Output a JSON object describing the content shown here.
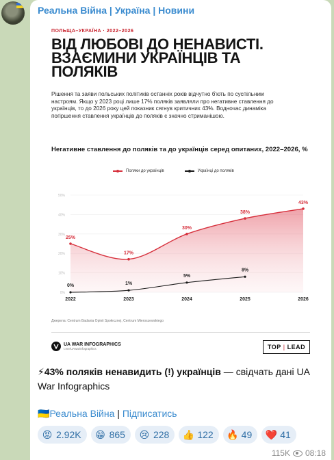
{
  "channel": {
    "title": "Реальна Війна | Україна | Новини"
  },
  "infographic": {
    "eyebrow": "ПОЛЬЩА–УКРАЇНА · 2022–2026",
    "headline": "ВІД ЛЮБОВІ ДО НЕНАВИСТІ. ВЗАЄМИНИ УКРАЇНЦІВ ТА ПОЛЯКІВ",
    "lead": "Рішення та заяви польських політиків останніх років відчутно б'ють по суспільним настроям. Якщо у 2023 році лише 17% поляків заявляли про негативне ставлення до українців, то до 2026 року цей показник сягнув критичних 43%. Водночас динаміка погіршення ставлення українців до поляків є значно стриманішою.",
    "chart_title": "Негативне ставлення до поляків та до українців серед опитаних, 2022–2026, %",
    "source": "Джерела: Centrum Badania Opinii Społecznej, Centrum Mieroszewskiego",
    "brand_name": "UA WAR INFOGRAPHICS",
    "brand_handle": "t.me/UAwarinfographics",
    "badge_left": "TOP",
    "badge_sep": "|",
    "badge_right": "LEAD"
  },
  "chart_data": {
    "type": "area",
    "x": [
      "2022",
      "2023",
      "2024",
      "2025",
      "2026"
    ],
    "ylim": [
      0,
      50
    ],
    "yticks": [
      "0%",
      "10%",
      "20%",
      "30%",
      "40%",
      "50%"
    ],
    "grid": true,
    "legend_position": "top",
    "series": [
      {
        "name": "Поляки до українців",
        "color": "#d62f3b",
        "values": [
          25,
          17,
          30,
          38,
          43
        ],
        "labels": [
          "25%",
          "17%",
          "30%",
          "38%",
          "43%"
        ]
      },
      {
        "name": "Українці до поляків",
        "color": "#1a1a1a",
        "values": [
          0,
          1,
          5,
          8,
          null
        ],
        "labels": [
          "0%",
          "1%",
          "5%",
          "8%",
          ""
        ]
      }
    ]
  },
  "post": {
    "bolt": "⚡",
    "bold_text": "43% поляків ненавидить (!) українців",
    "rest_text": " — свідчать дані UA War Infographics"
  },
  "signature": {
    "flag": "🇺🇦",
    "channel_link": "Реальна Війна",
    "separator": " | ",
    "subscribe_link": "Підписатись"
  },
  "reactions": [
    {
      "emoji": "😡",
      "count": "2.92K"
    },
    {
      "emoji": "😁",
      "count": "865"
    },
    {
      "emoji": "😢",
      "count": "228"
    },
    {
      "emoji": "👍",
      "count": "122"
    },
    {
      "emoji": "🔥",
      "count": "49"
    },
    {
      "emoji": "❤️",
      "count": "41"
    }
  ],
  "meta": {
    "views": "115K",
    "time": "08:18"
  },
  "colors": {
    "accent": "#3a8bcf",
    "red": "#c8202b",
    "chat_bg": "#c9d9b8"
  }
}
